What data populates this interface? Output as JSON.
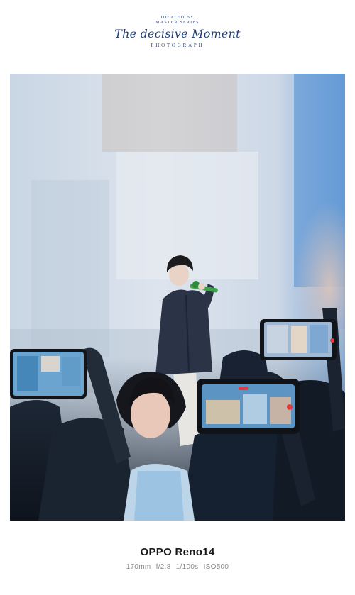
{
  "header": {
    "line1": "IDEATED BY",
    "line2": "MASTER SERIES",
    "brand_script": "The decisive Moment",
    "line3": "PHOTOGRAPH"
  },
  "footer": {
    "device": "OPPO Reno14",
    "specs": "170mm  f/2.8  1/100s  ISO500"
  },
  "colors": {
    "brand_blue": "#1f3e7a",
    "spec_gray": "#8a8a8a"
  }
}
